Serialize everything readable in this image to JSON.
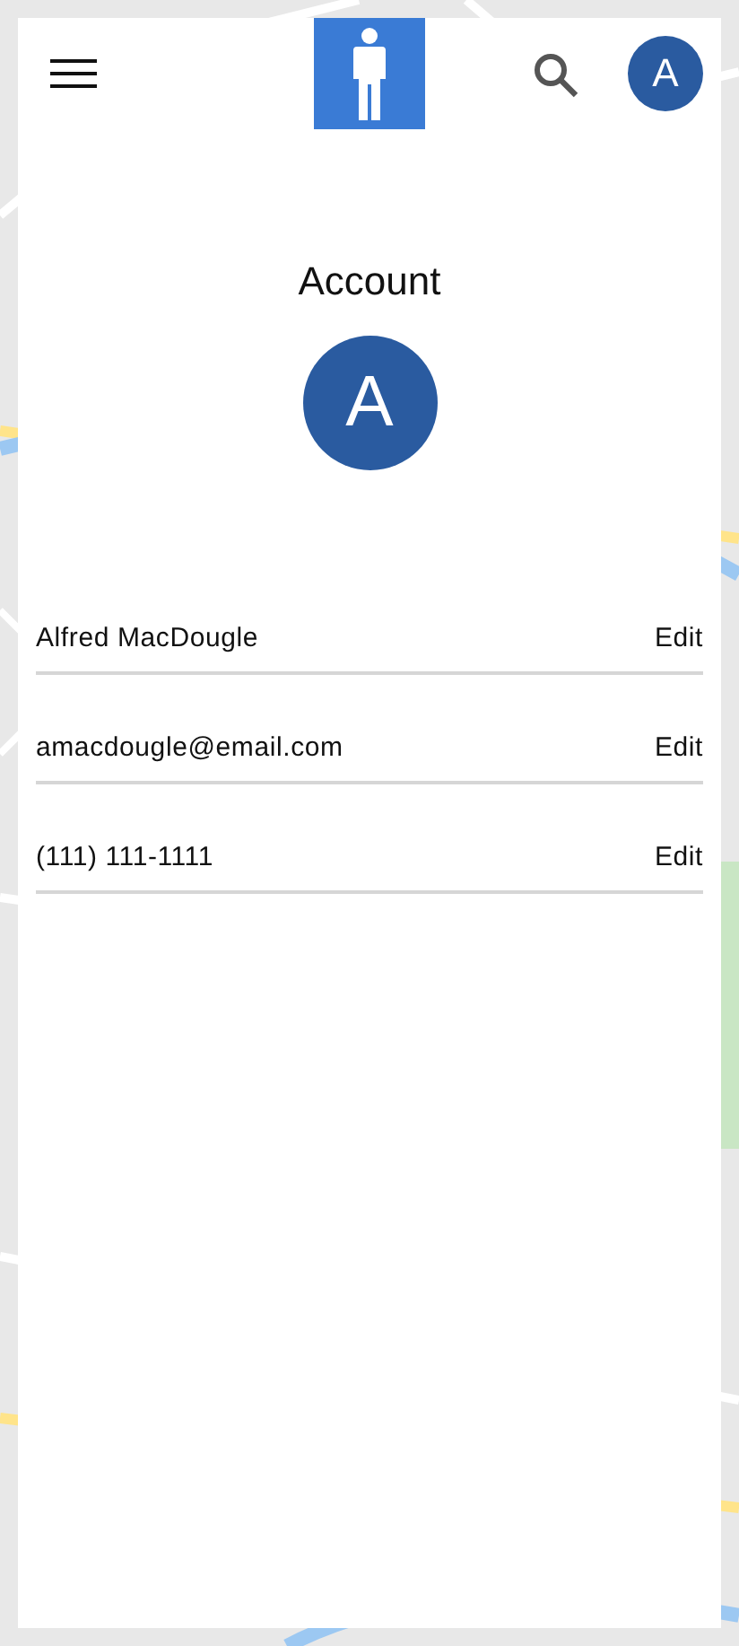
{
  "header": {
    "avatar_letter": "A"
  },
  "title": "Account",
  "profile_avatar": "A",
  "fields": [
    {
      "value": "Alfred MacDougle",
      "action": "Edit"
    },
    {
      "value": "amacdougle@email.com",
      "action": "Edit"
    },
    {
      "value": "(111) 111-1111",
      "action": "Edit"
    }
  ]
}
